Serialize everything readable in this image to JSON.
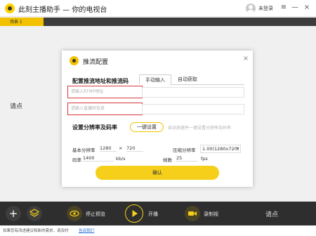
{
  "window": {
    "title": "此刻主播助手 — 你的电视台",
    "login_label": "未登录",
    "menu_glyph": "≡",
    "minimize_glyph": "—",
    "close_glyph": "×"
  },
  "scene_tabs": [
    {
      "label": "场景 1",
      "active": true
    }
  ],
  "background": {
    "hint_left": "请点",
    "hint_right": "请点"
  },
  "dialog": {
    "title": "推流配置",
    "close_glyph": "×",
    "stream_section": {
      "title": "配置推流地址和推流码",
      "tabs": [
        {
          "label": "手动输入",
          "active": true
        },
        {
          "label": "自动获取",
          "active": false
        }
      ],
      "rtmp_placeholder": "请输入RTMP地址",
      "stream_code_placeholder": "请输入直播码信息"
    },
    "resolution_section": {
      "title": "设置分辨率及码率",
      "one_click_label": "一键设置",
      "hint": "自动测速并一键设置分辨率及码率",
      "base_resolution_label": "基本分辨率",
      "base_width": "1280",
      "times_glyph": "×",
      "base_height": "720",
      "compressed_resolution_label": "压缩分辨率",
      "compressed_resolution_value": "1.00(1280x720)",
      "bitrate_label": "码率",
      "bitrate_value": "1400",
      "bitrate_unit": "kb/s",
      "fps_label": "帧数",
      "fps_value": "25",
      "fps_unit": "fps"
    },
    "confirm_label": "确认"
  },
  "toolbar": {
    "add_glyph": "+",
    "stop_preview_label": "停止预览",
    "start_broadcast_label": "开播",
    "rec_label": "录制视"
  },
  "status": {
    "text": "如果您有改进建议和新的需求，请及时",
    "link": "告诉我们"
  },
  "colors": {
    "accent": "#f5cf1a",
    "highlight_red": "#d9373a",
    "toolbar_bg": "#2e2e2e"
  }
}
